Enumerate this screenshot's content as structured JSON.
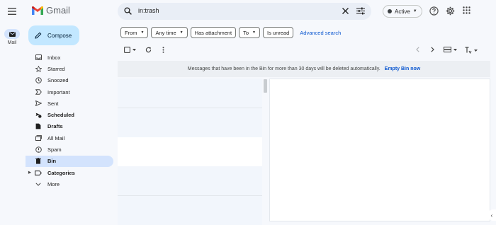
{
  "app": {
    "name": "Gmail",
    "rail_label": "Mail"
  },
  "colors": {
    "accent": "#0b57d0",
    "compose_bg": "#c2e7ff",
    "selected_bg": "#d3e3fd",
    "page_bg": "#f6f8fc"
  },
  "search": {
    "query": "in:trash"
  },
  "status": {
    "label": "Active"
  },
  "compose": {
    "label": "Compose"
  },
  "nav": {
    "items": [
      {
        "label": "Inbox",
        "icon": "inbox-icon"
      },
      {
        "label": "Starred",
        "icon": "star-icon"
      },
      {
        "label": "Snoozed",
        "icon": "clock-icon"
      },
      {
        "label": "Important",
        "icon": "important-icon"
      },
      {
        "label": "Sent",
        "icon": "send-icon"
      },
      {
        "label": "Scheduled",
        "icon": "scheduled-icon"
      },
      {
        "label": "Drafts",
        "icon": "draft-icon"
      },
      {
        "label": "All Mail",
        "icon": "all-mail-icon"
      },
      {
        "label": "Spam",
        "icon": "spam-icon"
      },
      {
        "label": "Bin",
        "icon": "trash-icon"
      },
      {
        "label": "Categories",
        "icon": "label-icon"
      },
      {
        "label": "More",
        "icon": "chevron-down-icon"
      }
    ]
  },
  "filters": {
    "from": "From",
    "any_time": "Any time",
    "has_attachment": "Has attachment",
    "to": "To",
    "is_unread": "Is unread",
    "advanced": "Advanced search"
  },
  "notice": {
    "text": "Messages that have been in the Bin for more than 30 days will be deleted automatically.",
    "action": "Empty Bin now"
  }
}
